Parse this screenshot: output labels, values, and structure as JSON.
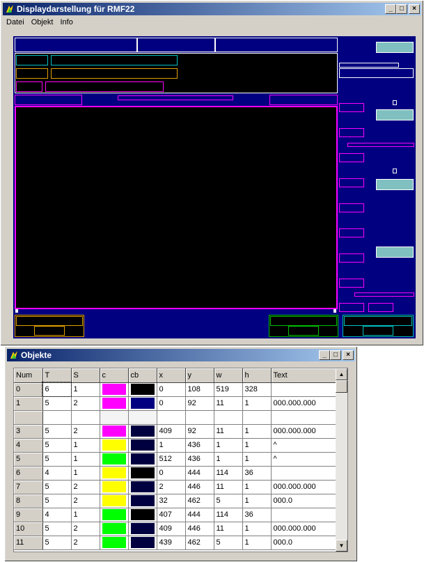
{
  "main_window": {
    "title": "Displaydarstellung für RMF22",
    "menu": [
      "Datei",
      "Objekt",
      "Info"
    ]
  },
  "colors": {
    "navy": "#000080",
    "black": "#000000",
    "magenta": "#ff00ff",
    "cyan": "#00c0c0",
    "orange": "#e0a000",
    "yellow": "#ffff00",
    "green": "#00ff00",
    "dark_navy": "#000040",
    "teal_fill": "#80c0c0"
  },
  "objects_window": {
    "title": "Objekte",
    "columns": [
      "Num",
      "T",
      "S",
      "c",
      "cb",
      "x",
      "y",
      "w",
      "h",
      "Text"
    ],
    "rows": [
      {
        "num": "0",
        "t": "6",
        "s": "1",
        "c": "#ff00ff",
        "cb": "#000000",
        "x": "0",
        "y": "108",
        "w": "519",
        "h": "328",
        "text": ""
      },
      {
        "num": "1",
        "t": "5",
        "s": "2",
        "c": "#ff00ff",
        "cb": "#000080",
        "x": "0",
        "y": "92",
        "w": "11",
        "h": "1",
        "text": "000.000.000"
      },
      {
        "num": "",
        "t": "",
        "s": "",
        "c": "",
        "cb": "",
        "x": "",
        "y": "",
        "w": "",
        "h": "",
        "text": ""
      },
      {
        "num": "3",
        "t": "5",
        "s": "2",
        "c": "#ff00ff",
        "cb": "#000040",
        "x": "409",
        "y": "92",
        "w": "11",
        "h": "1",
        "text": "000.000.000"
      },
      {
        "num": "4",
        "t": "5",
        "s": "1",
        "c": "#ffff00",
        "cb": "#000040",
        "x": "1",
        "y": "436",
        "w": "1",
        "h": "1",
        "text": "^"
      },
      {
        "num": "5",
        "t": "5",
        "s": "1",
        "c": "#00ff00",
        "cb": "#000040",
        "x": "512",
        "y": "436",
        "w": "1",
        "h": "1",
        "text": "^"
      },
      {
        "num": "6",
        "t": "4",
        "s": "1",
        "c": "#ffff00",
        "cb": "#000000",
        "x": "0",
        "y": "444",
        "w": "114",
        "h": "36",
        "text": ""
      },
      {
        "num": "7",
        "t": "5",
        "s": "2",
        "c": "#ffff00",
        "cb": "#000040",
        "x": "2",
        "y": "446",
        "w": "11",
        "h": "1",
        "text": "000.000.000"
      },
      {
        "num": "8",
        "t": "5",
        "s": "2",
        "c": "#ffff00",
        "cb": "#000040",
        "x": "32",
        "y": "462",
        "w": "5",
        "h": "1",
        "text": "000.0"
      },
      {
        "num": "9",
        "t": "4",
        "s": "1",
        "c": "#00ff00",
        "cb": "#000000",
        "x": "407",
        "y": "444",
        "w": "114",
        "h": "36",
        "text": ""
      },
      {
        "num": "10",
        "t": "5",
        "s": "2",
        "c": "#00ff00",
        "cb": "#000040",
        "x": "409",
        "y": "446",
        "w": "11",
        "h": "1",
        "text": "000.000.000"
      },
      {
        "num": "11",
        "t": "5",
        "s": "2",
        "c": "#00ff00",
        "cb": "#000040",
        "x": "439",
        "y": "462",
        "w": "5",
        "h": "1",
        "text": "000.0"
      }
    ]
  }
}
